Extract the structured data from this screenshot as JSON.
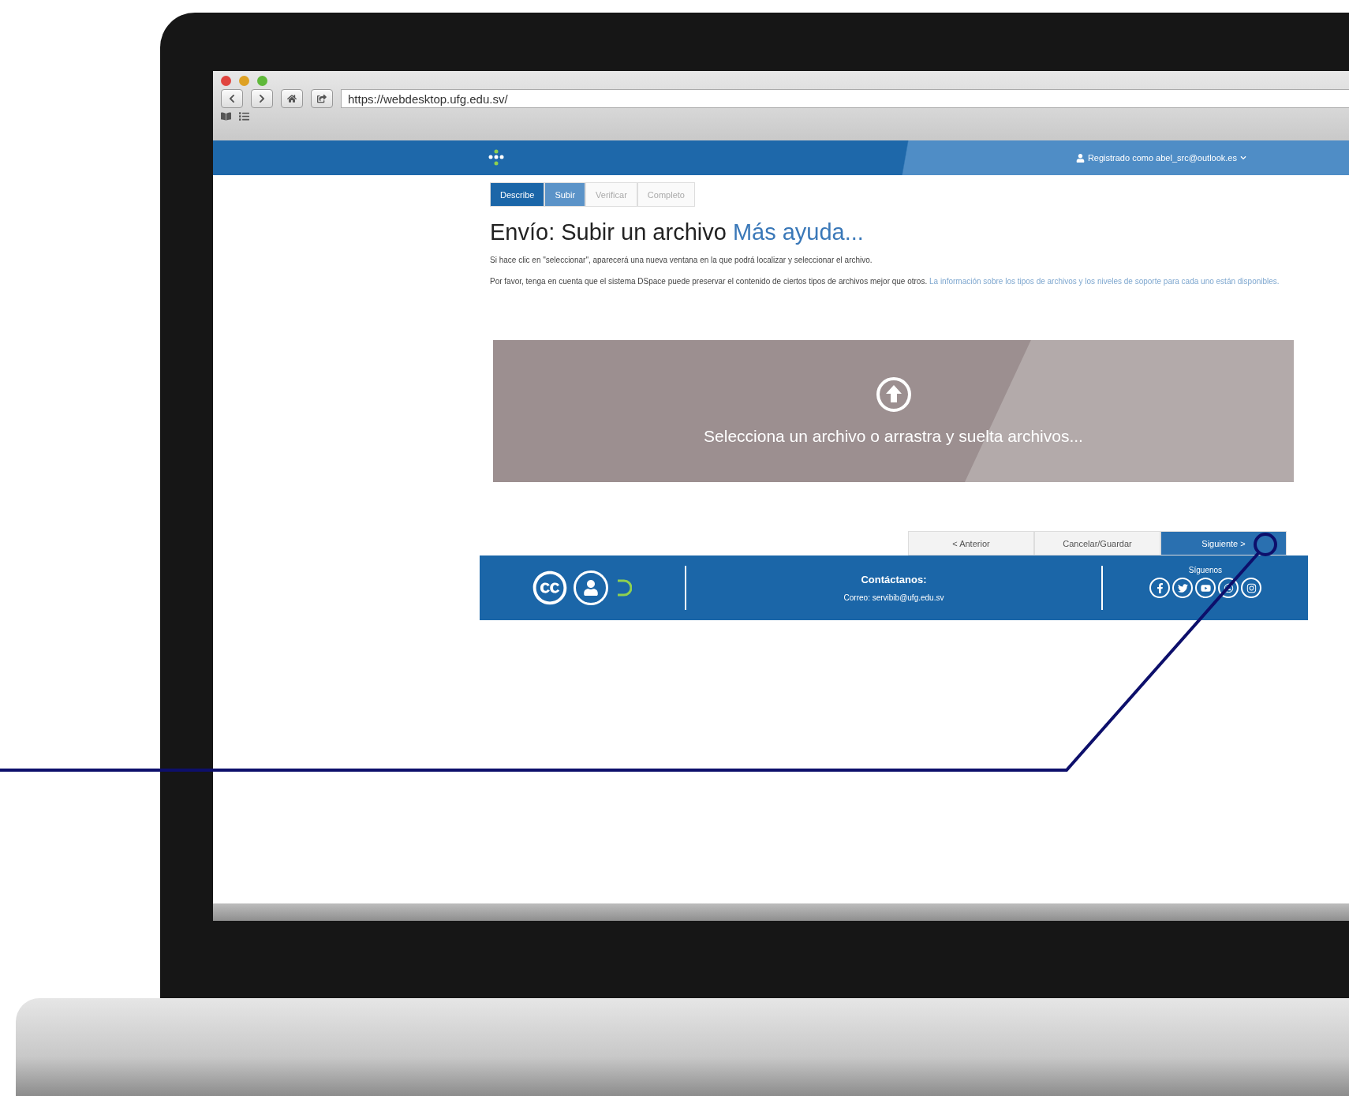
{
  "browser": {
    "url": "https://webdesktop.ufg.edu.sv/"
  },
  "navbar": {
    "user": "Registrado como abel_src@outlook.es"
  },
  "steps": [
    {
      "label": "Describe",
      "selected": false,
      "done": true
    },
    {
      "label": "Subir",
      "selected": true,
      "done": false
    },
    {
      "label": "Verificar",
      "selected": false,
      "done": false
    },
    {
      "label": "Completo",
      "selected": false,
      "done": false
    }
  ],
  "page": {
    "title": "Envío: Subir un archivo",
    "help_link": "Más ayuda...",
    "intro": "Si hace clic en \"seleccionar\", aparecerá una nueva ventana en la que podrá localizar y seleccionar el archivo.",
    "note": "Por favor, tenga en cuenta que el sistema DSpace puede preservar el contenido de ciertos tipos de archivos mejor que otros.",
    "note_link": "La información sobre los tipos de archivos y los niveles de soporte para cada uno están disponibles."
  },
  "dropzone": {
    "label": "Selecciona un archivo o arrastra y suelta archivos..."
  },
  "buttons": [
    {
      "label": "< Anterior",
      "primary": false
    },
    {
      "label": "Cancelar/Guardar",
      "primary": false
    },
    {
      "label": "Siguiente >",
      "primary": true
    }
  ],
  "footer": {
    "contact_title": "Contáctanos:",
    "contact_email": "Correo: servibib@ufg.edu.sv",
    "follow": "Síguenos"
  }
}
